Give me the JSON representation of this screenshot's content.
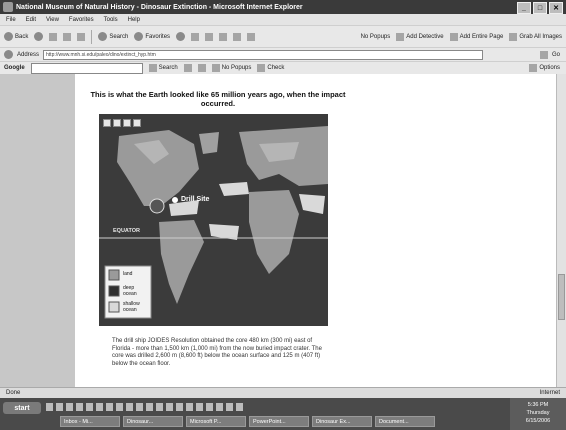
{
  "window": {
    "title": "National Museum of Natural History - Dinosaur Extinction - Microsoft Internet Explorer",
    "controls": [
      "_",
      "□",
      "✕"
    ]
  },
  "menu": [
    "File",
    "Edit",
    "View",
    "Favorites",
    "Tools",
    "Help"
  ],
  "toolbar": {
    "back": "Back",
    "search": "Search",
    "favorites": "Favorites",
    "popups": "No Popups",
    "add_detective": "Add Detective",
    "add_entire_page": "Add Entire Page",
    "grab_images": "Grab All Images"
  },
  "address": {
    "label": "Address",
    "url": "http://www.mnh.si.edu/paleo/dino/extinct_hyp.htm",
    "go": "Go"
  },
  "google": {
    "label": "Google",
    "search": "Search",
    "popups": "No Popups",
    "check": "Check",
    "options": "Options"
  },
  "page": {
    "caption": "This is what the Earth looked like 65 million years ago, when the impact occurred.",
    "map": {
      "drill_label": "Drill Site",
      "equator": "EQUATOR",
      "legend": [
        {
          "label": "land",
          "color": "#9a9a9a"
        },
        {
          "label": "deep ocean",
          "color": "#2f2f2f"
        },
        {
          "label": "shallow ocean",
          "color": "#d9d9d9"
        }
      ]
    },
    "body": "The drill ship JOIDES Resolution obtained the core 480 km (300 mi) east of Florida - more than 1,500 km (1,000 mi) from the now buried impact crater. The core was drilled 2,600 m (8,600 ft) below the ocean surface and 125 m (407 ft) below the ocean floor."
  },
  "status": {
    "left": "Done",
    "right": "Internet"
  },
  "taskbar": {
    "start": "start",
    "tasks": [
      "Inbox - Mi...",
      "Dinosaur...",
      "Microsoft P...",
      "PowerPoint...",
      "Dinosaur Ex...",
      "Document..."
    ],
    "clock": "5:36 PM",
    "day": "Thursday",
    "date": "6/15/2006"
  }
}
